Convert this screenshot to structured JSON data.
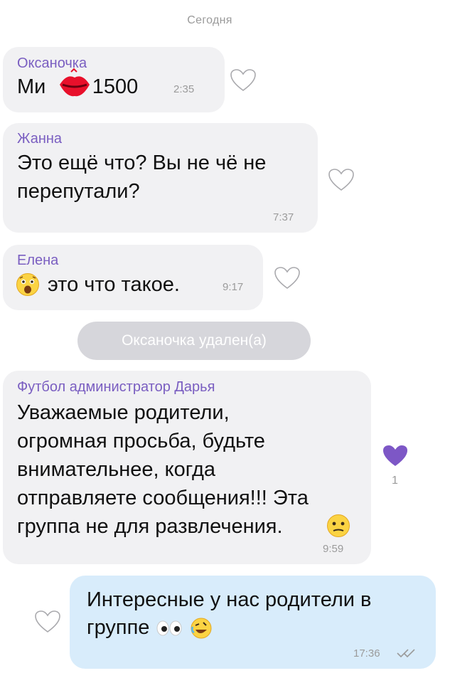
{
  "date_separator": "Сегодня",
  "messages": [
    {
      "sender": "Оксаночка",
      "text_line1": "Ми",
      "text_line1_end": "т 1500",
      "time": "2:35"
    },
    {
      "sender": "Жанна",
      "text_line1": "Это ещё что? Вы не чё не",
      "text_line2": "перепутали?",
      "time": "7:37"
    },
    {
      "sender": "Елена",
      "text_line1": "это что такое.",
      "time": "9:17",
      "emoji": "astonished-face"
    },
    {
      "sender": "Футбол администратор Дарья",
      "text_line1": "Уважаемые родители,",
      "text_line2": "огромная просьба, будьте",
      "text_line3": "внимательнее, когда",
      "text_line4": "отправляете сообщения!!! Эта",
      "text_line5": "группа не для развлечения.",
      "time": "9:59",
      "likes": "1",
      "emoji": "confused-face"
    },
    {
      "text_line1": "Интересные у нас родители в",
      "text_line2": "группе",
      "time": "17:36",
      "emoji": [
        "eyes",
        "rolling-on-floor-laughing"
      ]
    }
  ],
  "system_notice": "Оксаночка удален(а)",
  "colors": {
    "accent": "#7a5ec1",
    "liked_heart": "#7d57c6",
    "incoming_bubble": "#f1f1f3",
    "outgoing_bubble": "#d8ecfb"
  }
}
